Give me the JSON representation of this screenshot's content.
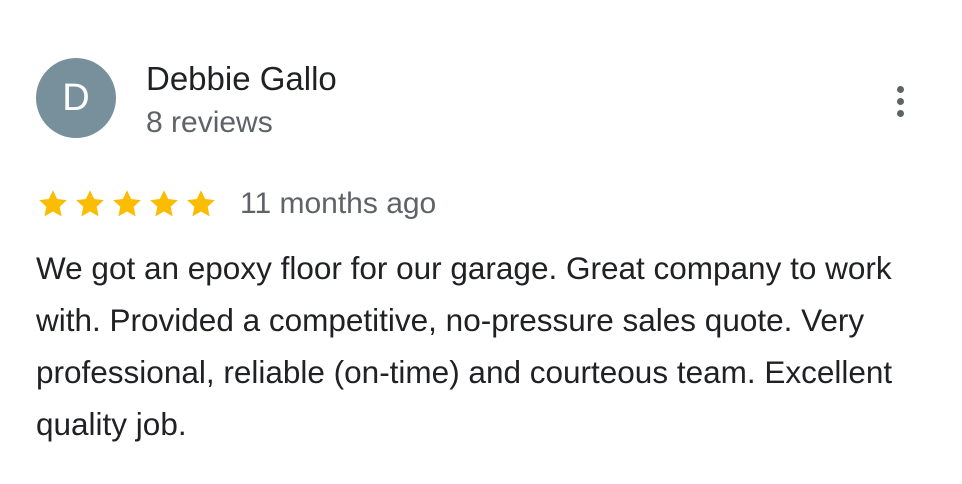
{
  "reviewer": {
    "initial": "D",
    "name": "Debbie Gallo",
    "reviews_count": "8 reviews",
    "avatar_color": "#78909c"
  },
  "more_options": {
    "icon": "more-vert-icon"
  },
  "rating": {
    "stars": 5,
    "max_stars": 5,
    "star_color": "#fbbc04",
    "date": "11 months ago"
  },
  "review": {
    "text": "We got an epoxy floor for our garage. Great company to work with. Provided a competitive, no-pressure sales quote. Very professional, reliable (on-time) and courteous team. Excellent quality job."
  }
}
